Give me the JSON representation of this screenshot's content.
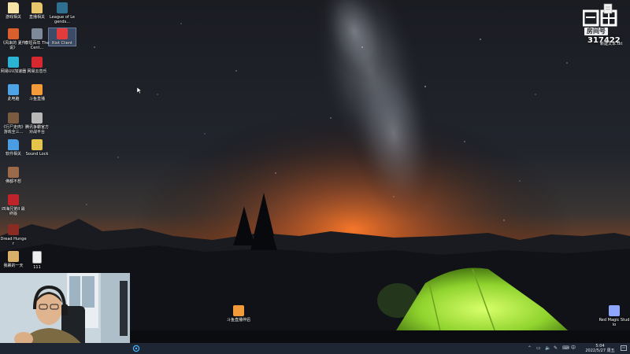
{
  "desktop": {
    "icons": [
      {
        "label": "游戏相关",
        "icon": "folder-icon",
        "color": "#f3e3a6"
      },
      {
        "label": "直播相关",
        "icon": "folder-icon",
        "color": "#e8c66b"
      },
      {
        "label": "League of Legends...",
        "icon": "league-of-legends-icon",
        "color": "#2f6f8f"
      },
      {
        "label": "《风来的 夏传说》",
        "icon": "game-icon",
        "color": "#d9602d"
      },
      {
        "label": "泰坦百年 The Cent...",
        "icon": "game-icon",
        "color": "#7c8a9a"
      },
      {
        "label": "Riot Client",
        "icon": "riot-client-icon",
        "color": "#e23b3b"
      },
      {
        "label": "网易UU加速器",
        "icon": "uu-accelerator-icon",
        "color": "#2bb3d4"
      },
      {
        "label": "网易云音乐",
        "icon": "netease-music-icon",
        "color": "#d8282f"
      },
      {
        "label": "此电脑",
        "icon": "this-pc-icon",
        "color": "#4da3e6"
      },
      {
        "label": "斗鱼直播",
        "icon": "douyu-icon",
        "color": "#f29b38"
      },
      {
        "label": "《行尸走肉》 游戏全三...",
        "icon": "game-icon",
        "color": "#7a5b3f"
      },
      {
        "label": "腾讯争霸官方 对战平台",
        "icon": "battle-platform-icon",
        "color": "#b8b8b8"
      },
      {
        "label": "软件相关",
        "icon": "folder-icon",
        "color": "#4a9de0"
      },
      {
        "label": "Sound Lock",
        "icon": "sound-lock-icon",
        "color": "#e5c44c"
      },
      {
        "label": "佛都不想",
        "icon": "game-icon",
        "color": "#9a6a4a"
      },
      {
        "label": "四海兄弟II 最 终版",
        "icon": "game-icon",
        "color": "#c0242b"
      },
      {
        "label": "Dread Hunger",
        "icon": "dread-hunger-icon",
        "color": "#8a2b24"
      },
      {
        "label": "我裹的一天",
        "icon": "game-icon",
        "color": "#d9b06a"
      },
      {
        "label": "111",
        "icon": "text-file-icon",
        "color": "#f0f0f0"
      },
      {
        "label": "斗鱼直播伴侣",
        "icon": "douyu-companion-icon",
        "color": "#f29b38"
      },
      {
        "label": "Red Magic Studio",
        "icon": "red-magic-studio-icon",
        "color": "#8fa6ff"
      }
    ]
  },
  "overlay": {
    "logo_text": "斗鱼",
    "room_label": "房间号",
    "room_number": "317422",
    "file_label": "新建文本.txt"
  },
  "taskbar": {
    "tray_icons": [
      "chevron-up-icon",
      "network-icon",
      "speaker-icon",
      "pen-icon",
      "input-icon"
    ],
    "ime_label": "中",
    "time": "5:04",
    "date": "2022/5/27 周五",
    "notification_icon": "notification-icon"
  },
  "colors": {
    "sky_top": "#1b1d24",
    "sky_glow": "#c2551f",
    "tent": "#9bdc3a",
    "taskbar": "#1e2633"
  }
}
